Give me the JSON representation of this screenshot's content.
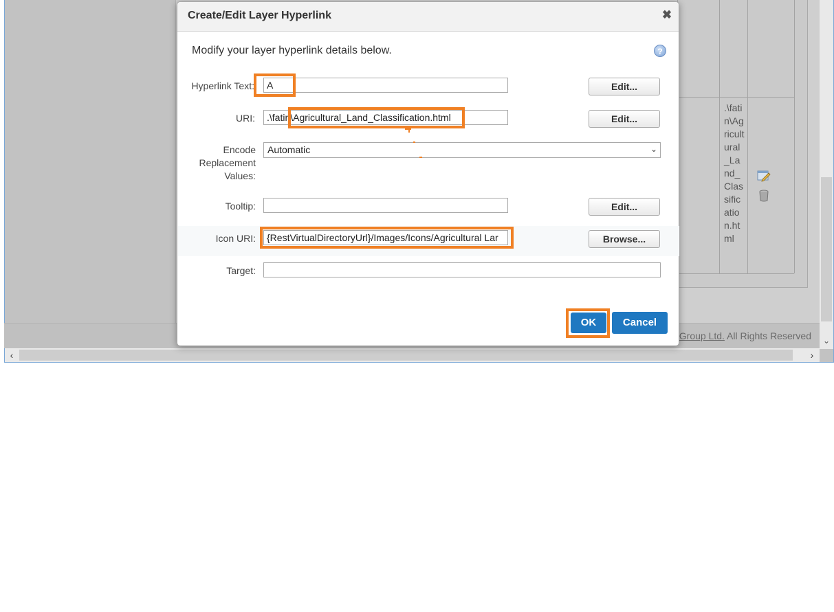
{
  "background": {
    "table_uri_text": ".\\fatin\\Agricultural_Land_Classification.html",
    "footer": {
      "link": "Group Ltd.",
      "text": " All Rights Reserved"
    }
  },
  "dialog": {
    "title": "Create/Edit Layer Hyperlink",
    "close_glyph": "✖",
    "intro": "Modify your layer hyperlink details below.",
    "help_glyph": "?",
    "fields": {
      "hyperlink_text": {
        "label": "Hyperlink Text:",
        "value": "A"
      },
      "uri": {
        "label": "URI:",
        "value": ".\\fatin\\Agricultural_Land_Classification.html"
      },
      "encode": {
        "label_line1": "Encode",
        "label_line2": "Replacement",
        "label_line3": "Values:",
        "value": "Automatic"
      },
      "tooltip": {
        "label": "Tooltip:",
        "value": ""
      },
      "icon_uri": {
        "label": "Icon URI:",
        "value": "{RestVirtualDirectoryUrl}/Images/Icons/Agricultural Lar"
      },
      "target": {
        "label": "Target:",
        "value": ""
      }
    },
    "buttons": {
      "edit": "Edit...",
      "browse": "Browse...",
      "ok": "OK",
      "cancel": "Cancel"
    }
  },
  "icons": {
    "edit": "edit-pencil-icon",
    "delete": "trash-can-icon",
    "help": "help-question-icon",
    "close": "close-x-icon"
  },
  "colors": {
    "highlight": "#f08024",
    "primary_button": "#1f78c1"
  }
}
